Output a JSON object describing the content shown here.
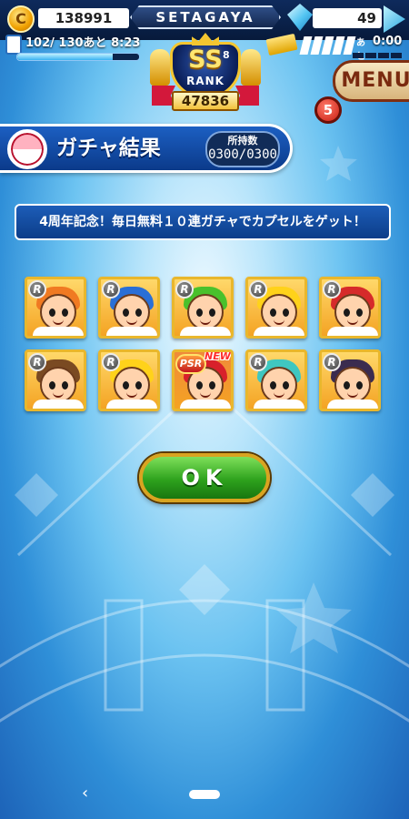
{
  "status_bar": {
    "coins": "138991",
    "coin_icon_glyph": "C",
    "location": "SETAGAYA",
    "gems": "49",
    "stamina_text": "102/ 130あと  8:23",
    "stamina_fraction": 0.785,
    "ticket_label": "あと",
    "ticket_time": "0:00"
  },
  "rank": {
    "grade": "SS",
    "grade_sub": "8",
    "label": "RANK",
    "score": "47836"
  },
  "menu": {
    "label": "MENU",
    "notification_count": "5"
  },
  "result_header": {
    "title": "ガチャ結果",
    "owned_label": "所持数",
    "owned_count": "0300/0300"
  },
  "campaign_banner": "4周年記念！毎日無料１０連ガチャでカプセルをゲット！",
  "cards": [
    {
      "rarity": "R",
      "hair": "#f07a22",
      "bg": "#ffd86a",
      "new": ""
    },
    {
      "rarity": "R",
      "hair": "#2a6fd6",
      "bg": "#ffd86a",
      "new": ""
    },
    {
      "rarity": "R",
      "hair": "#49c12c",
      "bg": "#ffd86a",
      "new": ""
    },
    {
      "rarity": "R",
      "hair": "#ffd21a",
      "bg": "#ffd86a",
      "new": ""
    },
    {
      "rarity": "R",
      "hair": "#d62a2a",
      "bg": "#ffd86a",
      "new": ""
    },
    {
      "rarity": "R",
      "hair": "#7a4a22",
      "bg": "#ffd86a",
      "new": ""
    },
    {
      "rarity": "R",
      "hair": "#ffd21a",
      "bg": "#ffd86a",
      "new": ""
    },
    {
      "rarity": "PSR",
      "hair": "#d8202b",
      "bg": "#f08a3a",
      "new": "NEW"
    },
    {
      "rarity": "R",
      "hair": "#3fc7c0",
      "bg": "#ffd86a",
      "new": ""
    },
    {
      "rarity": "R",
      "hair": "#3b2c4f",
      "bg": "#ffd86a",
      "new": ""
    }
  ],
  "ok_button": "OK",
  "nav": {
    "back_glyph": "‹"
  },
  "icons": {
    "coin": "coin-icon",
    "gem": "gem-icon",
    "gem_add": "gem-add-icon",
    "stamina": "stamina-icon",
    "ticket": "ticket-icon",
    "capsule": "capsule-icon",
    "home": "home-pill-icon",
    "back": "back-chevron-icon"
  }
}
